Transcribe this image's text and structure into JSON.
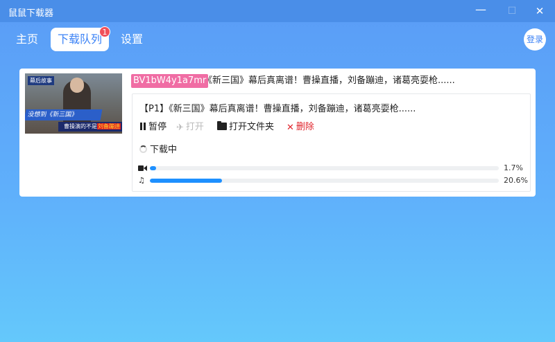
{
  "window": {
    "title": "鼠鼠下载器",
    "minimize": "—",
    "maximize": "☐",
    "close": "✕"
  },
  "nav": {
    "tabs": [
      {
        "label": "主页",
        "active": false
      },
      {
        "label": "下载队列",
        "active": true,
        "badge": "1"
      },
      {
        "label": "设置",
        "active": false
      }
    ],
    "login": "登录"
  },
  "download": {
    "bvid": "BV1bW4y1a7mr",
    "title": "《新三国》幕后真离谱！曹操直播，刘备蹦迪，诸葛亮耍枪......",
    "thumbnail": {
      "tag": "幕后故事",
      "banner1": "没想到《新三国》",
      "banner2_prefix": "曹操演的不是",
      "banner2_highlight": "刘备蹦迪"
    },
    "part": {
      "title": "【P1】《新三国》幕后真离谱！曹操直播，刘备蹦迪，诸葛亮耍枪......",
      "actions": {
        "pause": "暂停",
        "open": "打开",
        "open_folder": "打开文件夹",
        "delete": "删除"
      },
      "status": "下载中",
      "video_progress": {
        "percent": 1.7,
        "label": "1.7%"
      },
      "audio_progress": {
        "percent": 20.6,
        "label": "20.6%"
      }
    }
  },
  "colors": {
    "accent": "#1e90ff",
    "bvid_tag": "#f06da4",
    "delete": "#e0242c",
    "badge": "#f0505a"
  }
}
